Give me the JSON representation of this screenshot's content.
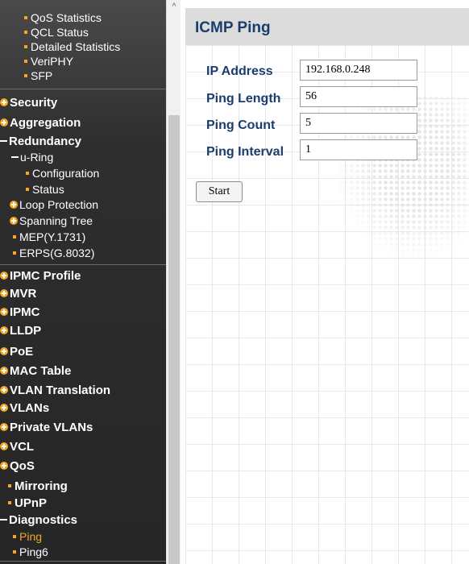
{
  "sidebar": {
    "items": [
      {
        "label": "QoS Statistics"
      },
      {
        "label": "QCL Status"
      },
      {
        "label": "Detailed Statistics"
      },
      {
        "label": "VeriPHY"
      },
      {
        "label": "SFP"
      },
      {
        "label": "Security"
      },
      {
        "label": "Aggregation"
      },
      {
        "label": "Redundancy"
      },
      {
        "label": "u-Ring"
      },
      {
        "label": "Configuration"
      },
      {
        "label": "Status"
      },
      {
        "label": "Loop Protection"
      },
      {
        "label": "Spanning Tree"
      },
      {
        "label": "MEP(Y.1731)"
      },
      {
        "label": "ERPS(G.8032)"
      },
      {
        "label": "IPMC Profile"
      },
      {
        "label": "MVR"
      },
      {
        "label": "IPMC"
      },
      {
        "label": "LLDP"
      },
      {
        "label": "PoE"
      },
      {
        "label": "MAC Table"
      },
      {
        "label": "VLAN Translation"
      },
      {
        "label": "VLANs"
      },
      {
        "label": "Private VLANs"
      },
      {
        "label": "VCL"
      },
      {
        "label": "QoS"
      },
      {
        "label": "Mirroring"
      },
      {
        "label": "UPnP"
      },
      {
        "label": "Diagnostics"
      },
      {
        "label": "Ping"
      },
      {
        "label": "Ping6"
      }
    ],
    "active_item": "Ping",
    "accent_color": "#f5a623"
  },
  "page": {
    "title": "ICMP Ping"
  },
  "form": {
    "ip_address": {
      "label": "IP Address",
      "value": "192.168.0.248"
    },
    "ping_length": {
      "label": "Ping Length",
      "value": "56"
    },
    "ping_count": {
      "label": "Ping Count",
      "value": "5"
    },
    "ping_interval": {
      "label": "Ping Interval",
      "value": "1"
    },
    "start_label": "Start"
  },
  "colors": {
    "title": "#1a3d6e",
    "header_bar": "#dcdcdc",
    "nav_background": "#2e2e2e"
  }
}
